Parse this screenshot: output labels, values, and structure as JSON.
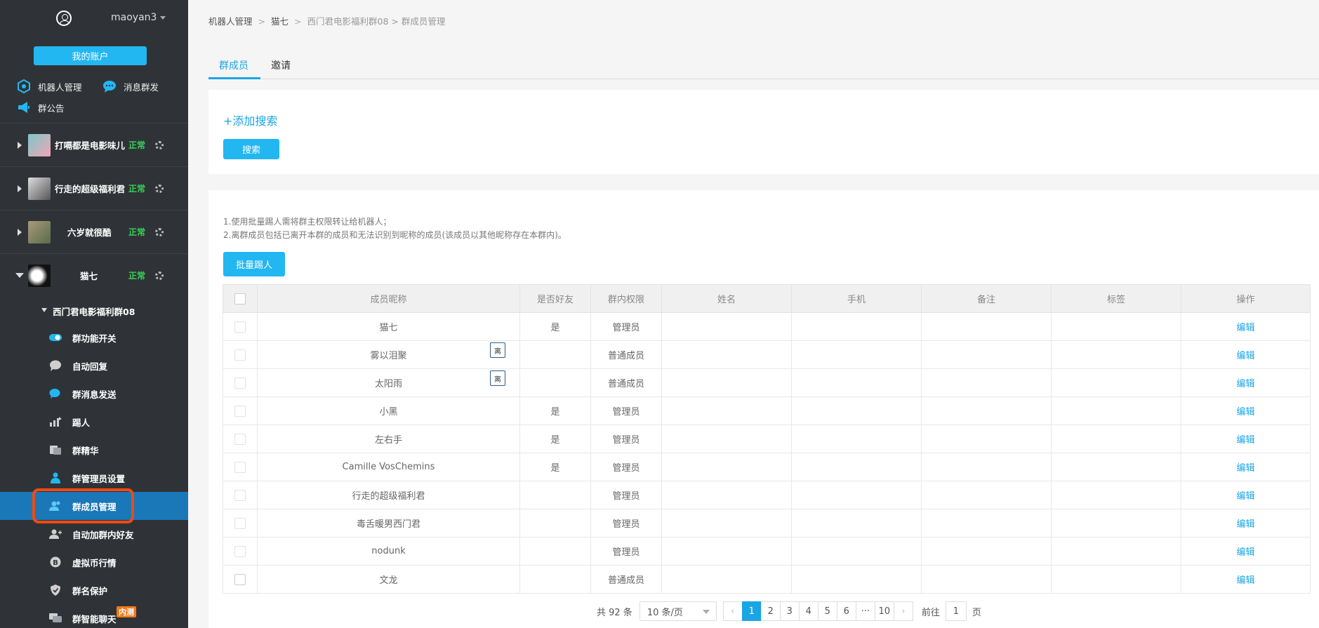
{
  "sidebar": {
    "username": "maoyan3",
    "account_button": "我的账户",
    "quick_links": [
      {
        "label": "机器人管理",
        "icon": "robot-icon"
      },
      {
        "label": "消息群发",
        "icon": "chat-bubble-icon"
      },
      {
        "label": "群公告",
        "icon": "megaphone-icon"
      }
    ],
    "bots": [
      {
        "name": "打嗝都是电影味儿",
        "status": "正常"
      },
      {
        "name": "行走的超级福利君",
        "status": "正常"
      },
      {
        "name": "六岁就很酷",
        "status": "正常"
      },
      {
        "name": "猫七",
        "status": "正常"
      }
    ],
    "group_name": "西门君电影福利群08",
    "menu": [
      {
        "label": "群功能开关",
        "icon": "toggle-icon"
      },
      {
        "label": "自动回复",
        "icon": "reply-bubble-icon"
      },
      {
        "label": "群消息发送",
        "icon": "message-send-icon"
      },
      {
        "label": "踢人",
        "icon": "kick-icon"
      },
      {
        "label": "群精华",
        "icon": "essence-icon"
      },
      {
        "label": "群管理员设置",
        "icon": "admin-icon"
      },
      {
        "label": "群成员管理",
        "icon": "members-icon",
        "active": true
      },
      {
        "label": "自动加群内好友",
        "icon": "add-friend-icon"
      },
      {
        "label": "虚拟币行情",
        "icon": "bitcoin-icon"
      },
      {
        "label": "群名保护",
        "icon": "shield-icon"
      },
      {
        "label": "群智能聊天",
        "icon": "smart-chat-icon"
      }
    ],
    "beta_badge": "内测"
  },
  "breadcrumb": [
    "机器人管理",
    "猫七",
    "西门君电影福利群08",
    "群成员管理"
  ],
  "tabs": [
    "群成员",
    "邀请"
  ],
  "search": {
    "add_label": "+添加搜索",
    "button": "搜索"
  },
  "notes": [
    "1.使用批量踢人需将群主权限转让给机器人；",
    "2.离群成员包括已离开本群的成员和无法识别到昵称的成员(该成员以其他昵称存在本群内)。"
  ],
  "kick_button": "批量踢人",
  "table": {
    "columns": [
      "成员昵称",
      "是否好友",
      "群内权限",
      "姓名",
      "手机",
      "备注",
      "标签",
      "操作"
    ],
    "rows": [
      {
        "nickname": "猫七",
        "friend": "是",
        "role": "管理员",
        "left": "",
        "action": "编辑"
      },
      {
        "nickname": "雾以泪聚",
        "friend": "",
        "role": "普通成员",
        "left": "离",
        "action": "编辑"
      },
      {
        "nickname": "太阳雨",
        "friend": "",
        "role": "普通成员",
        "left": "离",
        "action": "编辑"
      },
      {
        "nickname": "小黑",
        "friend": "是",
        "role": "管理员",
        "left": "",
        "action": "编辑"
      },
      {
        "nickname": "左右手",
        "friend": "是",
        "role": "管理员",
        "left": "",
        "action": "编辑"
      },
      {
        "nickname": "Camille VosChemins",
        "friend": "是",
        "role": "管理员",
        "left": "",
        "action": "编辑"
      },
      {
        "nickname": "行走的超级福利君",
        "friend": "",
        "role": "管理员",
        "left": "",
        "action": "编辑"
      },
      {
        "nickname": "毒舌暖男西门君",
        "friend": "",
        "role": "管理员",
        "left": "",
        "action": "编辑"
      },
      {
        "nickname": "nodunk",
        "friend": "",
        "role": "管理员",
        "left": "",
        "action": "编辑"
      },
      {
        "nickname": "文龙",
        "friend": "",
        "role": "普通成员",
        "left": "",
        "action": "编辑"
      }
    ]
  },
  "pagination": {
    "total": "共 92 条",
    "page_size": "10 条/页",
    "pages": [
      "1",
      "2",
      "3",
      "4",
      "5",
      "6",
      "···",
      "10"
    ],
    "current": "1",
    "goto_label": "前往",
    "goto_value": "1",
    "page_suffix": "页"
  },
  "colors": {
    "accent": "#1aa5e5",
    "sidebar_bg": "#2f3337",
    "active_menu": "#1a77b8",
    "status_ok": "#37d159",
    "highlight": "#f04a12"
  }
}
